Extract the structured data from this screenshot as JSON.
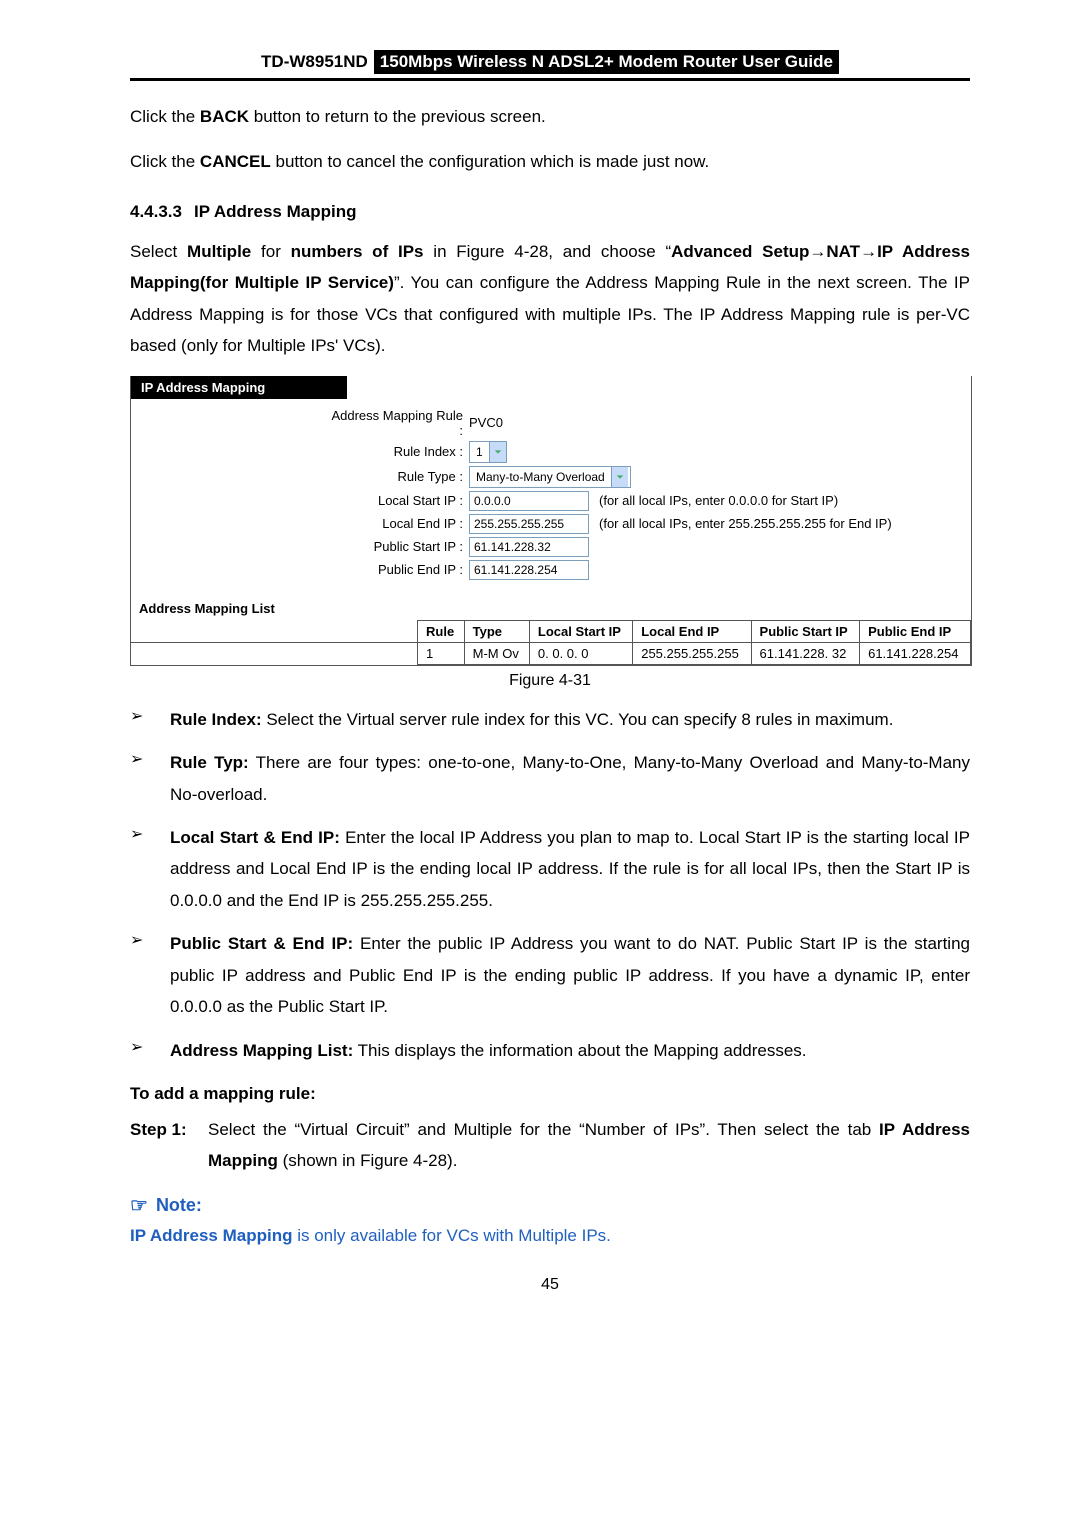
{
  "header": {
    "model": "TD-W8951ND",
    "title": "150Mbps Wireless N ADSL2+ Modem Router User Guide"
  },
  "para": {
    "p1a": "Click the ",
    "p1b": "BACK",
    "p1c": " button to return to the previous screen.",
    "p2a": "Click the ",
    "p2b": "CANCEL",
    "p2c": " button to cancel the configuration which is made just now."
  },
  "section": {
    "num": "4.4.3.3",
    "title": "IP Address Mapping"
  },
  "sectionPara": {
    "t1": "Select ",
    "t2": "Multiple",
    "t3": " for ",
    "t4": "numbers of IPs",
    "t5": " in Figure 4-28, and choose “",
    "t6": "Advanced Setup→NAT→IP Address Mapping(for Multiple IP Service)",
    "t7": "”. You can configure the Address Mapping Rule in the next screen. The IP Address Mapping is for those VCs that configured with multiple IPs. The IP Address Mapping rule is per-VC based (only for Multiple IPs' VCs)."
  },
  "panel": {
    "tab": "IP Address Mapping",
    "lines": {
      "addrRuleLabel": "Address Mapping Rule :",
      "addrRuleVal": "PVC0",
      "ruleIndexLabel": "Rule Index :",
      "ruleIndexVal": "1",
      "ruleTypeLabel": "Rule Type :",
      "ruleTypeVal": "Many-to-Many Overload",
      "localStartLabel": "Local Start IP :",
      "localStartVal": "0.0.0.0",
      "localStartHint": "(for all local IPs, enter 0.0.0.0 for Start IP)",
      "localEndLabel": "Local End IP :",
      "localEndVal": "255.255.255.255",
      "localEndHint": "(for all local IPs, enter 255.255.255.255 for End IP)",
      "pubStartLabel": "Public Start IP :",
      "pubStartVal": "61.141.228.32",
      "pubEndLabel": "Public End IP :",
      "pubEndVal": "61.141.228.254"
    },
    "listLabel": "Address Mapping List",
    "headers": {
      "rule": "Rule",
      "type": "Type",
      "lstart": "Local Start IP",
      "lend": "Local End IP",
      "pstart": "Public Start IP",
      "pend": "Public End IP"
    },
    "row": {
      "rule": "1",
      "type": "M-M Ov",
      "lstart": "0. 0. 0. 0",
      "lend": "255.255.255.255",
      "pstart": "61.141.228. 32",
      "pend": "61.141.228.254"
    }
  },
  "figCaption": "Figure 4-31",
  "bullets": {
    "b1": {
      "strong": "Rule Index:",
      "rest": " Select the Virtual server rule index for this VC. You can specify 8 rules in maximum."
    },
    "b2": {
      "strong": "Rule Typ:",
      "rest": " There are four types: one-to-one, Many-to-One, Many-to-Many Overload and Many-to-Many No-overload."
    },
    "b3": {
      "strong": "Local Start & End IP:",
      "rest": " Enter the local IP Address you plan to map to. Local Start IP is the starting local IP address and Local End IP is the ending local IP address. If the rule is for all local IPs, then the Start IP is 0.0.0.0 and the End IP is 255.255.255.255."
    },
    "b4": {
      "strong": "Public Start & End IP:",
      "rest": " Enter the public IP Address you want to do NAT. Public Start IP is the starting public IP address and Public End IP is the ending public IP address. If you have a dynamic IP, enter 0.0.0.0 as the Public Start IP."
    },
    "b5": {
      "strong": "Address Mapping List:",
      "rest": " This displays the information about the Mapping addresses."
    }
  },
  "addRuleHeading": "To add a mapping rule:",
  "step1": {
    "label": "Step 1:",
    "t1": "Select the “Virtual Circuit” and Multiple for the “Number of IPs”. Then select the tab ",
    "t2": "IP Address Mapping",
    "t3": " (shown in Figure 4-28)."
  },
  "note": {
    "label": "Note:",
    "body": "IP Address Mapping",
    "body2": " is only available for VCs with Multiple IPs."
  },
  "pageNum": "45"
}
